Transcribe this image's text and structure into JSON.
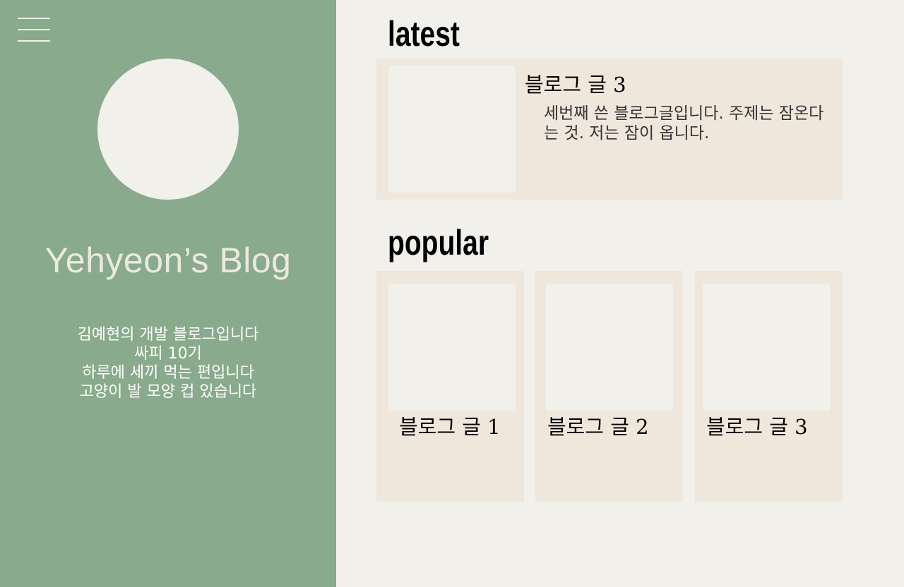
{
  "sidebar": {
    "site_title": "Yehyeon’s Blog",
    "intro_lines": [
      "김예현의 개발 블로그입니다",
      "싸피 10기",
      "하루에 세끼 먹는 편입니다",
      "고양이 발 모양 컵 있습니다"
    ]
  },
  "latest": {
    "heading": "latest",
    "post": {
      "title": "블로그 글 3",
      "excerpt": "세번째 쓴 블로그글입니다. 주제는 잠온다는 것. 저는 잠이 옵니다."
    }
  },
  "popular": {
    "heading": "popular",
    "posts": [
      {
        "title": "블로그 글 1"
      },
      {
        "title": "블로그 글 2"
      },
      {
        "title": "블로그 글 3"
      }
    ]
  },
  "colors": {
    "sidebar_bg": "#89aa8c",
    "page_bg": "#f1f0eb",
    "card_bg": "#efe7dc"
  }
}
